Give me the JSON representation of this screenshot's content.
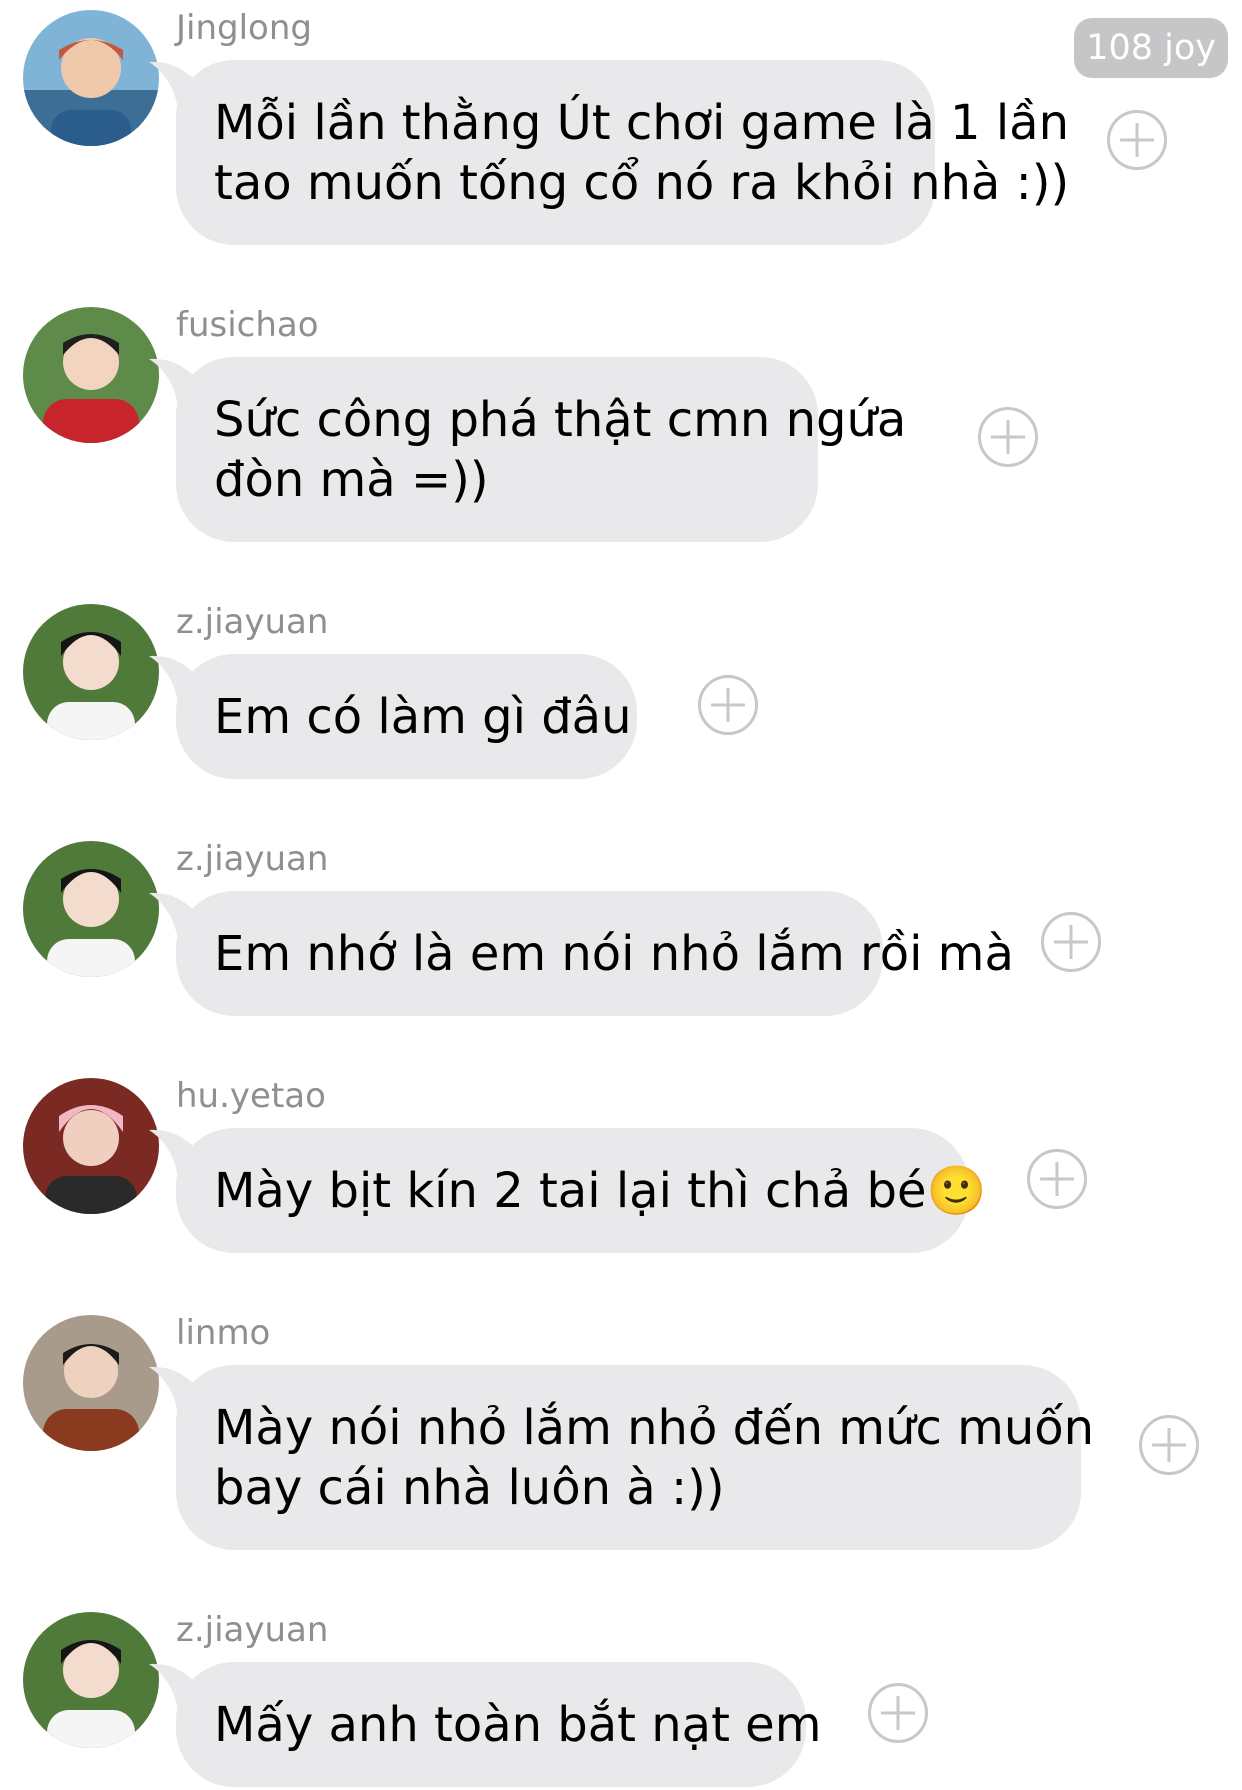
{
  "reaction_badge": "108 joy",
  "messages": [
    {
      "sender": "Jinglong",
      "lines": [
        "Mỗi lần thằng Út chơi game là 1 lần",
        "tao muốn tống cổ nó ra khỏi nhà :))"
      ]
    },
    {
      "sender": "fusichao",
      "lines": [
        "Sức công phá thật cmn ngứa",
        "đòn mà =))"
      ]
    },
    {
      "sender": "z.jiayuan",
      "lines": [
        "Em có làm gì đâu"
      ]
    },
    {
      "sender": "z.jiayuan",
      "lines": [
        "Em nhớ là em nói nhỏ lắm rồi mà"
      ]
    },
    {
      "sender": "hu.yetao",
      "lines": [
        "Mày bịt kín 2 tai lại thì chả bé🙂"
      ]
    },
    {
      "sender": "linmo",
      "lines": [
        "Mày nói nhỏ lắm nhỏ đến mức muốn",
        "bay cái nhà luôn à :))"
      ]
    },
    {
      "sender": "z.jiayuan",
      "lines": [
        "Mấy anh toàn bắt nạt em"
      ]
    }
  ]
}
